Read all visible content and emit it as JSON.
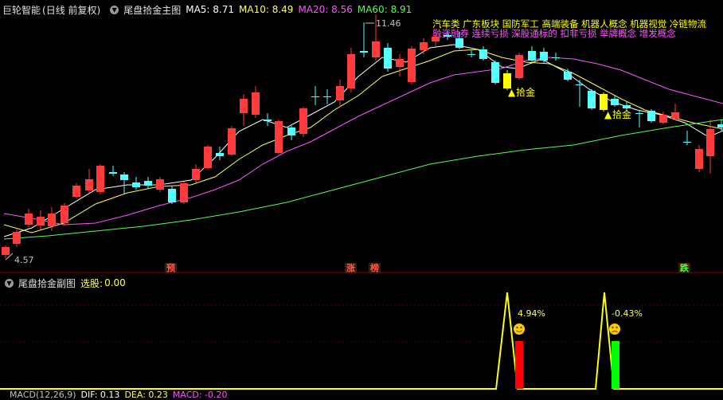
{
  "main": {
    "app_title": "巨轮智能",
    "period": "(日线 前复权)",
    "indicator_name": "尾盘拾金主图",
    "ma5": {
      "label": "MA5:",
      "value": "8.71",
      "color": "#ffffff"
    },
    "ma10": {
      "label": "MA10:",
      "value": "8.49",
      "color": "#ffff55"
    },
    "ma20": {
      "label": "MA20:",
      "value": "8.56",
      "color": "#ff55ff"
    },
    "ma60": {
      "label": "MA60:",
      "value": "8.91",
      "color": "#55ff55"
    },
    "high_price": "11.46",
    "low_price": "4.57",
    "concepts_line1": "汽车类    广东板块 国防军工 高端装备 机器人概念 机器视觉 冷链物流",
    "concepts_line2": "融资融券 连续亏损 深股通标的 扣非亏损 举牌概念 增发概念",
    "signal_label": "拾金",
    "markers": [
      {
        "text": "预",
        "color": "#ff5555"
      },
      {
        "text": "涨",
        "color": "#ff5555"
      },
      {
        "text": "榜",
        "color": "#ff5555"
      },
      {
        "text": "跌",
        "color": "#55ff55"
      }
    ]
  },
  "sub": {
    "indicator_name": "尾盘拾金副图",
    "select_label": "选股:",
    "select_value": "0.00",
    "pct1": "4.94%",
    "pct2": "-0.43%"
  },
  "macd": {
    "label": "MACD(12,26,9)",
    "dif": "DIF: 0.13",
    "dea": "DEA: 0.23",
    "macd_val": "MACD: -0.20"
  },
  "colors": {
    "up": "#ff3b3b",
    "down": "#54ffff",
    "signal": "#ffff00",
    "bg": "#000000",
    "grid": "#8b0000"
  }
}
